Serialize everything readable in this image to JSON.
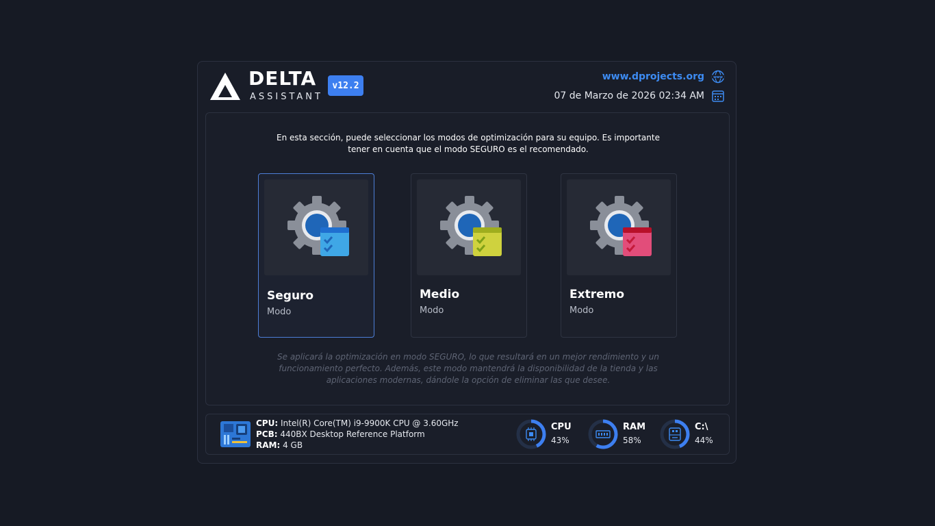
{
  "header": {
    "brand_title": "DELTA",
    "brand_subtitle": "ASSISTANT",
    "version": "v12.2",
    "website": "www.dprojects.org",
    "datetime": "07 de Marzo de 2026  02:34 AM"
  },
  "main": {
    "intro": "En esta sección, puede seleccionar los modos de optimización para su equipo. Es importante tener en cuenta que el modo SEGURO es el recomendado.",
    "modes": [
      {
        "title": "Seguro",
        "subtitle": "Modo",
        "color": "#3fa7e6",
        "selected": true
      },
      {
        "title": "Medio",
        "subtitle": "Modo",
        "color": "#cfd23e",
        "selected": false
      },
      {
        "title": "Extremo",
        "subtitle": "Modo",
        "color": "#e24d7a",
        "selected": false
      }
    ],
    "description": "Se aplicará la optimización en modo SEGURO, lo que resultará en un mejor rendimiento y un funcionamiento perfecto. Además, este modo mantendrá la disponibilidad de la tienda y las aplicaciones modernas, dándole la opción de eliminar las que desee."
  },
  "footer": {
    "cpu_label": "CPU:",
    "cpu_value": "Intel(R) Core(TM) i9-9900K CPU @ 3.60GHz",
    "pcb_label": "PCB:",
    "pcb_value": "440BX Desktop Reference Platform",
    "ram_label": "RAM:",
    "ram_value": "4 GB",
    "gauges": [
      {
        "label": "CPU",
        "value": "43%",
        "percent": 43,
        "icon": "chip-icon"
      },
      {
        "label": "RAM",
        "value": "58%",
        "percent": 58,
        "icon": "memory-icon"
      },
      {
        "label": "C:\\",
        "value": "44%",
        "percent": 44,
        "icon": "disk-icon"
      }
    ]
  },
  "colors": {
    "accent": "#3d7ff0",
    "link": "#3d8bf2",
    "selected_border": "#4d7fd8",
    "background": "#161a24"
  }
}
